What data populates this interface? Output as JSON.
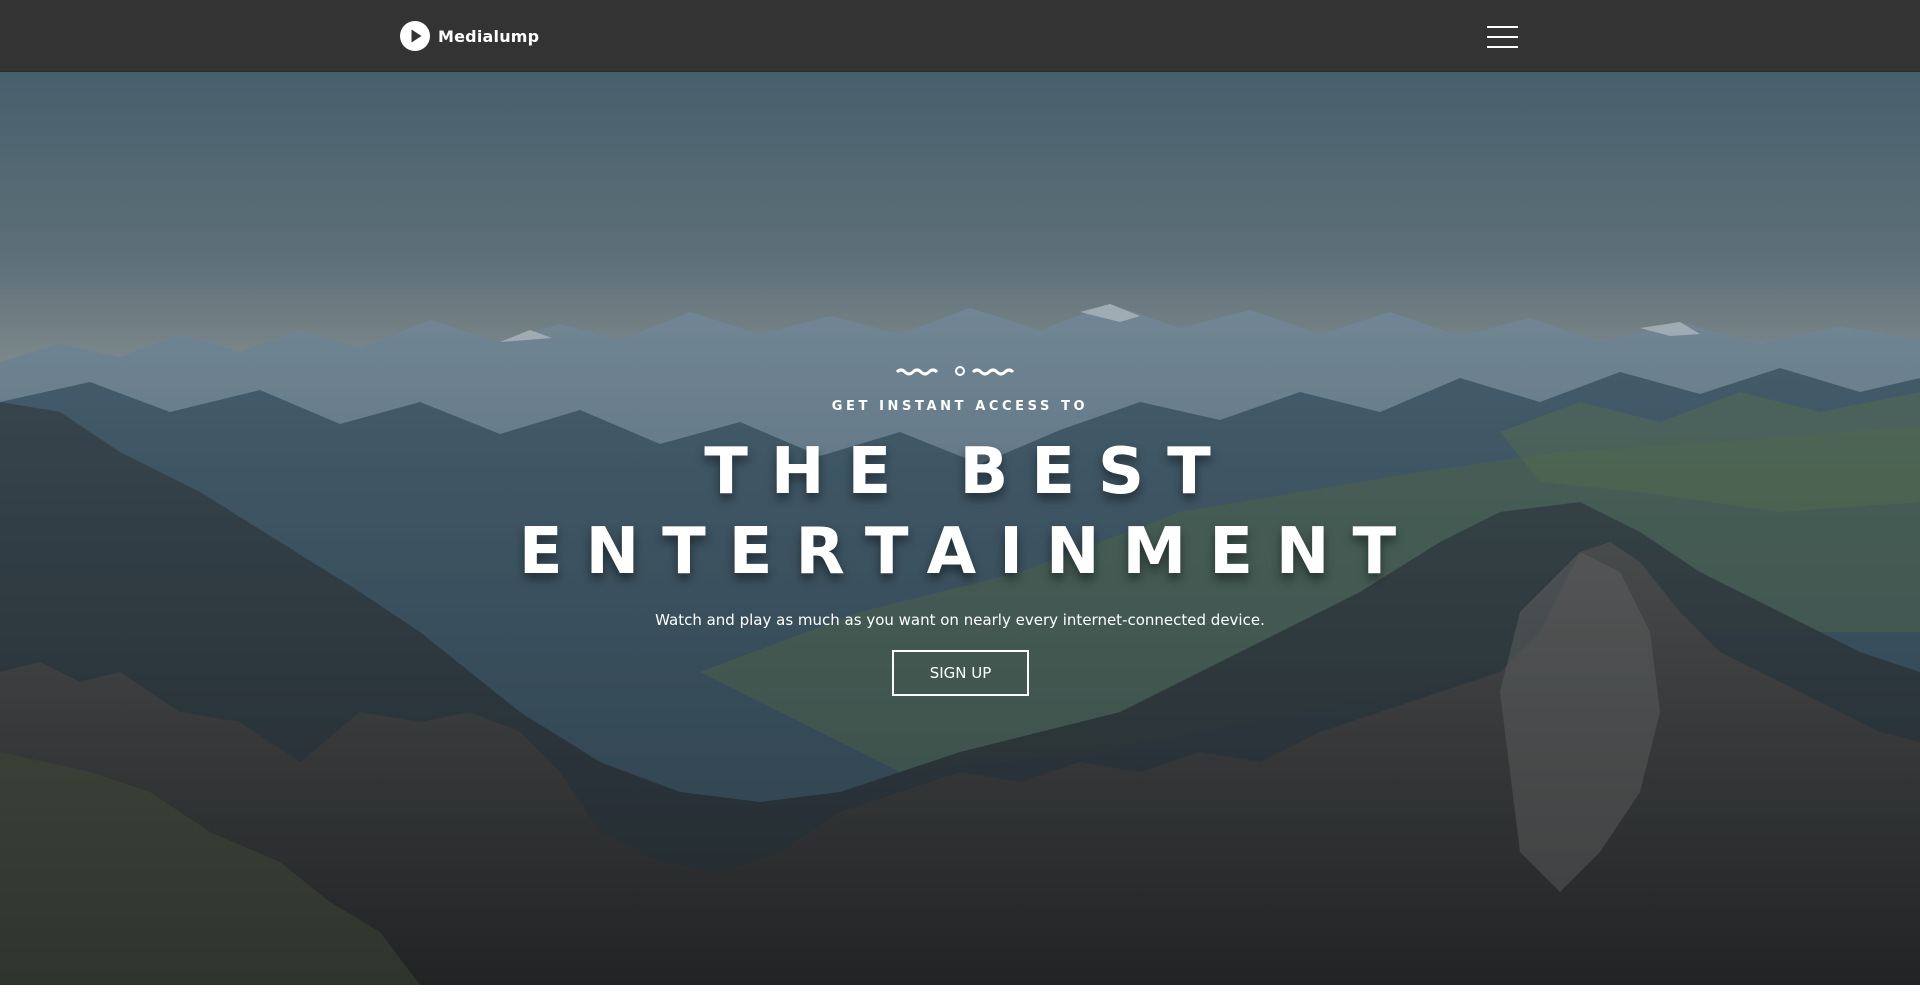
{
  "navbar": {
    "brand_name": "Medialump",
    "logo_icon": "play-circle-icon",
    "menu_icon": "hamburger-menu-icon"
  },
  "hero": {
    "divider_icon": "wavy-divider-icon",
    "eyebrow": "GET INSTANT ACCESS TO",
    "headline_line1": "THE BEST",
    "headline_line2": "ENTERTAINMENT",
    "tagline": "Watch and play as much as you want on nearly every internet-connected device.",
    "cta_label": "SIGN UP",
    "background": "mountain-landscape-image"
  },
  "colors": {
    "navbar_bg": "#333333",
    "text": "#ffffff",
    "sky_top": "#4b6574",
    "sky_horizon": "#9aa6a9",
    "mountain_dark": "#26313a"
  }
}
